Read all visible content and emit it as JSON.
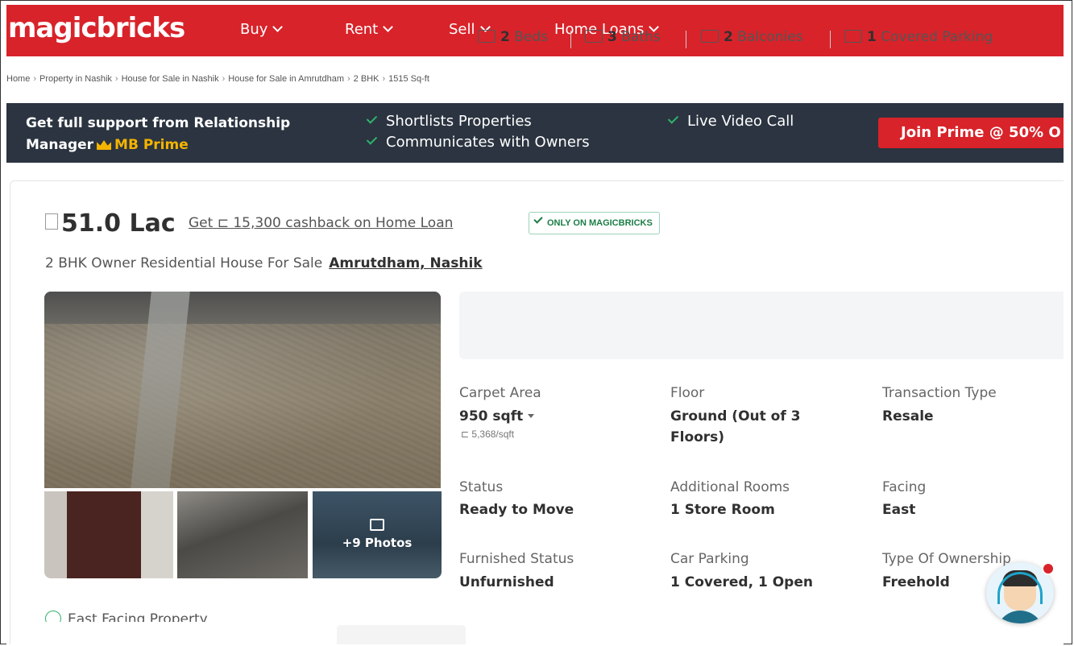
{
  "header": {
    "logo": "magicbricks",
    "nav": [
      {
        "label": "Buy"
      },
      {
        "label": "Rent"
      },
      {
        "label": "Sell"
      },
      {
        "label": "Home Loans"
      }
    ],
    "brand_color": "#d8232a"
  },
  "breadcrumb": [
    "Home",
    "Property in Nashik",
    "House for Sale in Nashik",
    "House for Sale in Amrutdham",
    "2 BHK",
    "1515 Sq-ft"
  ],
  "prime_banner": {
    "line1": "Get full support from Relationship",
    "line2": "Manager",
    "prime_label": "MB Prime",
    "features": [
      "Shortlists Properties",
      "Communicates with Owners",
      "Live Video Call"
    ],
    "cta": "Join Prime @ 50% O"
  },
  "listing": {
    "price": "51.0 Lac",
    "cashback": "Get ⊏ 15,300 cashback on Home Loan",
    "badge": "ONLY ON MAGICBRICKS",
    "subtitle": "2 BHK Owner Residential House For Sale",
    "location": "Amrutdham, Nashik",
    "more_photos": "+9 Photos",
    "amenities": [
      {
        "value": "2",
        "label": "Beds",
        "icon": "bed-icon"
      },
      {
        "value": "3",
        "label": "Baths",
        "icon": "bath-icon"
      },
      {
        "value": "2",
        "label": "Balconies",
        "icon": "balcony-icon"
      },
      {
        "value": "1",
        "label": "Covered Parking",
        "icon": "car-icon"
      }
    ],
    "details": {
      "carpet_area_label": "Carpet Area",
      "carpet_area_value": "950 sqft",
      "carpet_area_rate": "⊏ 5,368/sqft",
      "floor_label": "Floor",
      "floor_value": "Ground (Out of 3 Floors)",
      "transaction_label": "Transaction Type",
      "transaction_value": "Resale",
      "status_label": "Status",
      "status_value": "Ready to Move",
      "rooms_label": "Additional Rooms",
      "rooms_value": "1 Store Room",
      "facing_label": "Facing",
      "facing_value": "East",
      "furnished_label": "Furnished Status",
      "furnished_value": "Unfurnished",
      "parking_label": "Car Parking",
      "parking_value": "1 Covered, 1 Open",
      "ownership_label": "Type Of Ownership",
      "ownership_value": "Freehold"
    },
    "feature_tag": "East Facing Property"
  }
}
